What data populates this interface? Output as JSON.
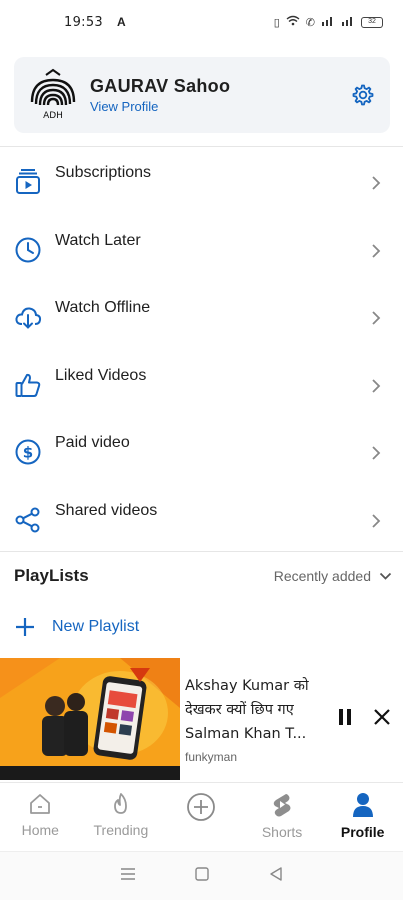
{
  "status_bar": {
    "time": "19:53",
    "alert": "A",
    "battery": "32"
  },
  "profile": {
    "name": "GAURAV Sahoo",
    "view_profile": "View Profile",
    "logo_text": "ADH"
  },
  "menu": [
    {
      "label": "Subscriptions",
      "icon": "subscriptions-icon"
    },
    {
      "label": "Watch Later",
      "icon": "clock-icon"
    },
    {
      "label": "Watch Offline",
      "icon": "cloud-download-icon"
    },
    {
      "label": "Liked Videos",
      "icon": "thumbs-up-icon"
    },
    {
      "label": "Paid video",
      "icon": "dollar-icon"
    },
    {
      "label": "Shared videos",
      "icon": "share-icon"
    }
  ],
  "playlists": {
    "title": "PlayLists",
    "sort": "Recently added",
    "new_playlist": "New Playlist"
  },
  "mini_player": {
    "title": "Akshay Kumar को देखकर क्यों छिप गए Salman Khan T...",
    "channel": "funkyman"
  },
  "bottom_nav": [
    {
      "label": "Home",
      "icon": "home-icon",
      "active": false
    },
    {
      "label": "Trending",
      "icon": "flame-icon",
      "active": false
    },
    {
      "label": "",
      "icon": "add-icon",
      "active": false
    },
    {
      "label": "Shorts",
      "icon": "shorts-icon",
      "active": false
    },
    {
      "label": "Profile",
      "icon": "profile-icon",
      "active": true
    }
  ],
  "colors": {
    "accent": "#1565c0",
    "card_bg": "#f2f4f7",
    "thumb_bg": "#f7a21b"
  }
}
